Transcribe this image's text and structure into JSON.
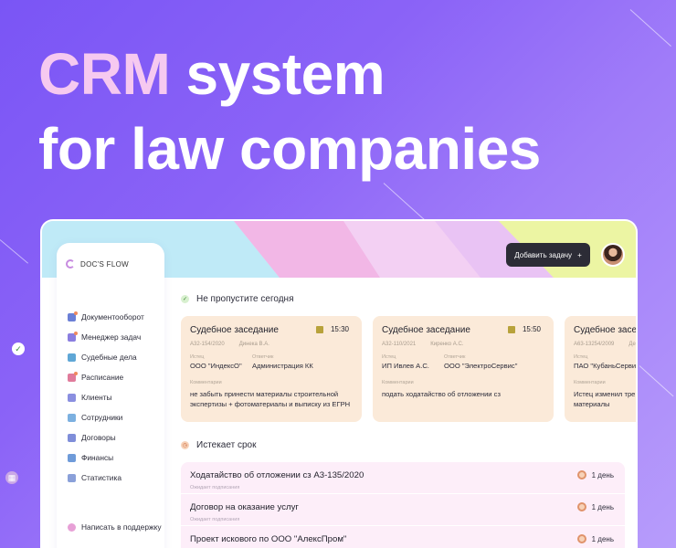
{
  "hero": {
    "accent": "CRM",
    "line1_rest": " system",
    "line2": "for law companies"
  },
  "app": {
    "logo": "DOC'S FLOW",
    "add_task_button": "Добавить задачу",
    "add_task_icon": "+",
    "sidebar": {
      "items": [
        {
          "label": "Документооборот",
          "icon": "documents-icon",
          "color": "#6b7fd6",
          "badge": true
        },
        {
          "label": "Менеджер задач",
          "icon": "tasks-icon",
          "color": "#8a7ee0",
          "badge": true
        },
        {
          "label": "Судебные дела",
          "icon": "court-icon",
          "color": "#5fa7d6",
          "badge": false
        },
        {
          "label": "Расписание",
          "icon": "calendar-icon",
          "color": "#e07b9b",
          "badge": true
        },
        {
          "label": "Клиенты",
          "icon": "clients-icon",
          "color": "#8a8fe0",
          "badge": false
        },
        {
          "label": "Сотрудники",
          "icon": "employees-icon",
          "color": "#7cb0e0",
          "badge": false
        },
        {
          "label": "Договоры",
          "icon": "contracts-icon",
          "color": "#7f8ed9",
          "badge": false
        },
        {
          "label": "Финансы",
          "icon": "finance-icon",
          "color": "#6f9bd9",
          "badge": false
        },
        {
          "label": "Статистика",
          "icon": "stats-icon",
          "color": "#8aa0d9",
          "badge": false
        }
      ],
      "support": "Написать в поддержку"
    },
    "today": {
      "title": "Не пропустите сегодня",
      "cards": [
        {
          "title": "Судебное заседание",
          "time": "15:30",
          "case": "А32-154/2020",
          "judge": "Динека В.А.",
          "plaintiff_label": "Истец",
          "plaintiff": "ООО \"ИндексО\"",
          "defendant_label": "Ответчик",
          "defendant": "Администрация КК",
          "comment_label": "Комментарии",
          "comment": "не забыть принести материалы строительной экспертизы + фотоматериалы и выписку из ЕГРН"
        },
        {
          "title": "Судебное заседание",
          "time": "15:50",
          "case": "А32-110/2021",
          "judge": "Киренко А.С.",
          "plaintiff_label": "Истец",
          "plaintiff": "ИП Ивлев А.С.",
          "defendant_label": "Ответчик",
          "defendant": "ООО \"ЭлектроСервис\"",
          "comment_label": "Комментарии",
          "comment": "подать ходатайство об отложении сз"
        },
        {
          "title": "Судебное заседание",
          "time": "",
          "case": "А63-13254/2009",
          "judge": "Де",
          "plaintiff_label": "Истец",
          "plaintiff": "ПАО \"КубаньСерви",
          "defendant_label": "",
          "defendant": "",
          "comment_label": "Комментарии",
          "comment": "Истец изменил тре и материалы"
        }
      ]
    },
    "deadline": {
      "title": "Истекает срок",
      "rows": [
        {
          "title": "Ходатайство об отложении сз  А3-135/2020",
          "status": "Ожидает подписания",
          "days": "1 день"
        },
        {
          "title": "Договор на оказание услуг",
          "status": "Ожидает подписания",
          "days": "1 день"
        },
        {
          "title": "Проект искового по ООО \"АлексПром\"",
          "status": "",
          "days": "1 день"
        }
      ]
    }
  }
}
